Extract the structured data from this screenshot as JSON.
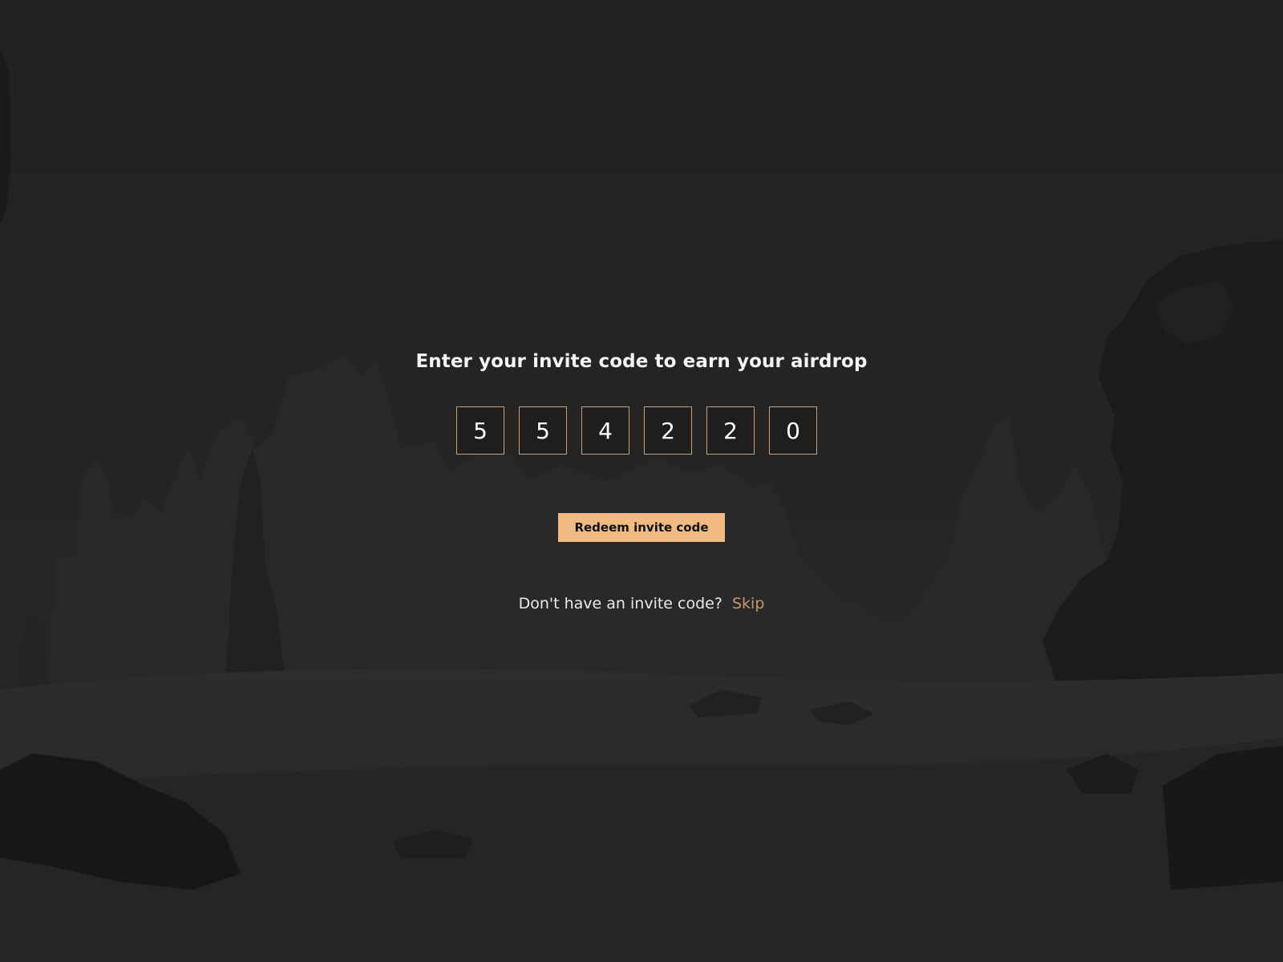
{
  "prompt": {
    "heading": "Enter your invite code to earn your airdrop"
  },
  "invite_code": {
    "digits": [
      "5",
      "5",
      "4",
      "2",
      "2",
      "0"
    ]
  },
  "actions": {
    "redeem_label": "Redeem invite code",
    "no_code_text": "Don't have an invite code?",
    "skip_label": "Skip"
  },
  "colors": {
    "accent": "#efbb82",
    "box_border": "#c9a27c",
    "link": "#c8986a",
    "background": "#232323"
  }
}
